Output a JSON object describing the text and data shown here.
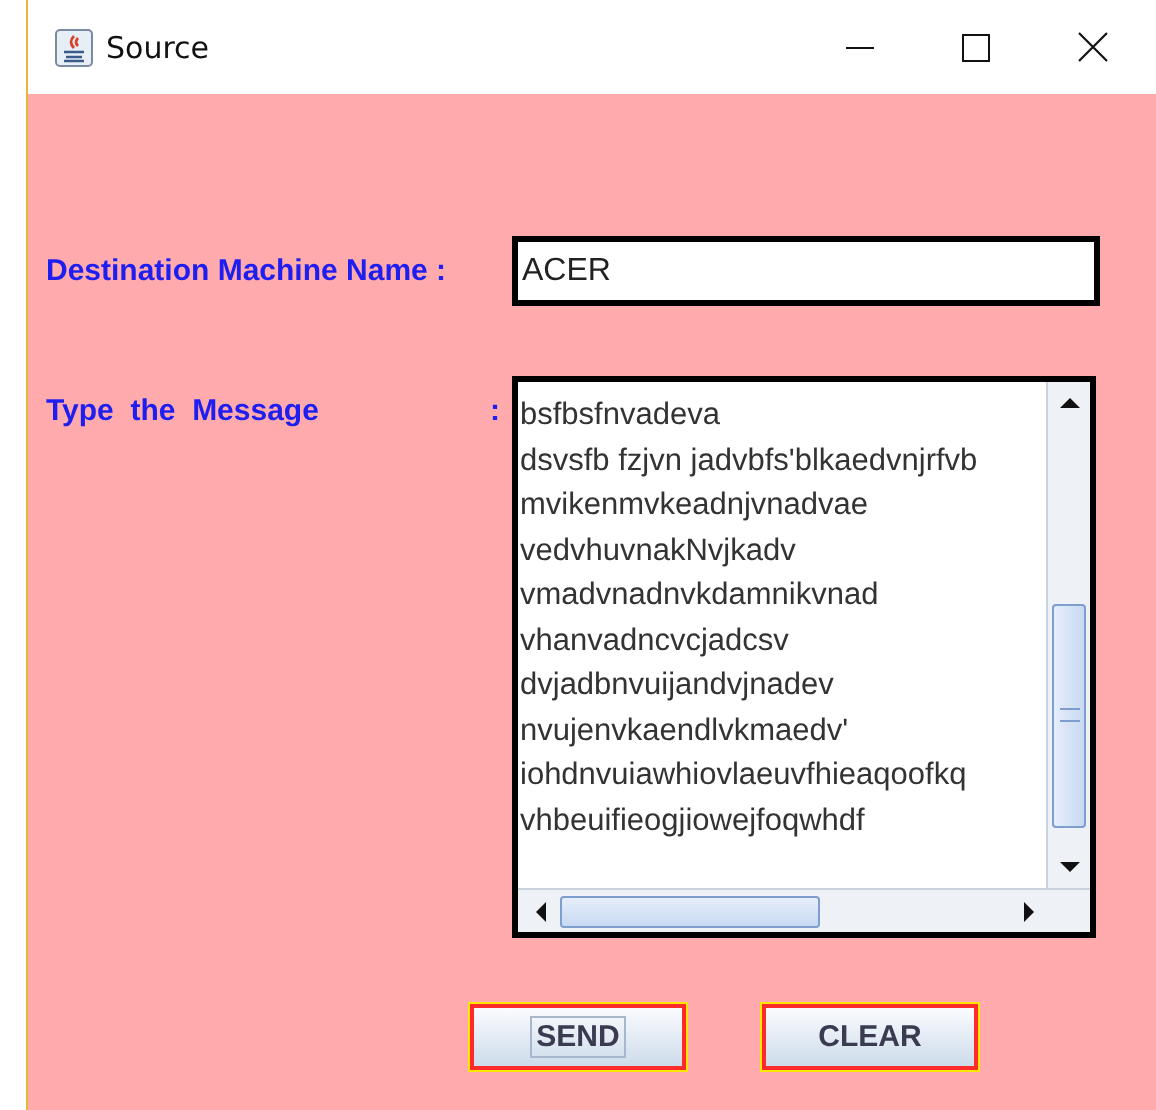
{
  "window": {
    "title": "Source"
  },
  "destination": {
    "label": "Destination Machine Name :",
    "value": "ACER"
  },
  "message": {
    "label": "Type  the  Message",
    "colon": ":",
    "lines": [
      "bsfbsfnvadeva",
      "dsvsfb fzjvn jadvbfs'blkaedvnjrfvb",
      "mvikenmvkeadnjvnadvae",
      "vedvhuvnakNvjkadv",
      "vmadvnadnvkdamnikvnad",
      "vhanvadncvcjadcsv",
      "dvjadbnvuijandvjnadev",
      "nvujenvkaendlvkmaedv'",
      "iohdnvuiawhiovlaeuvfhieaqoofkq",
      "vhbeuifieogjiowejfoqwhdf"
    ]
  },
  "buttons": [
    {
      "label": "SEND",
      "focused": true
    },
    {
      "label": "CLEAR",
      "focused": false
    }
  ]
}
